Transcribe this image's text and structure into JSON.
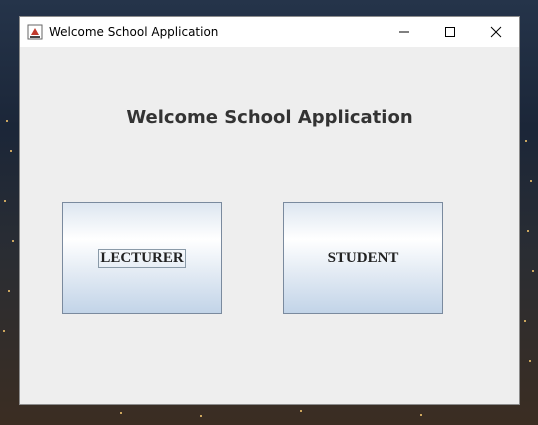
{
  "window": {
    "title": "Welcome School Application",
    "app_icon": "java-cup-icon",
    "controls": [
      "minimize-icon",
      "maximize-icon",
      "close-icon"
    ]
  },
  "main": {
    "heading": "Welcome School Application",
    "buttons": {
      "lecturer": "LECTURER",
      "student": "STUDENT"
    }
  },
  "colors": {
    "window_bg": "#eeeeee",
    "button_gradient_top": "#ffffff",
    "button_gradient_bottom": "#c2d4e8",
    "button_border": "#7a8a9e",
    "heading_text": "#333333"
  }
}
